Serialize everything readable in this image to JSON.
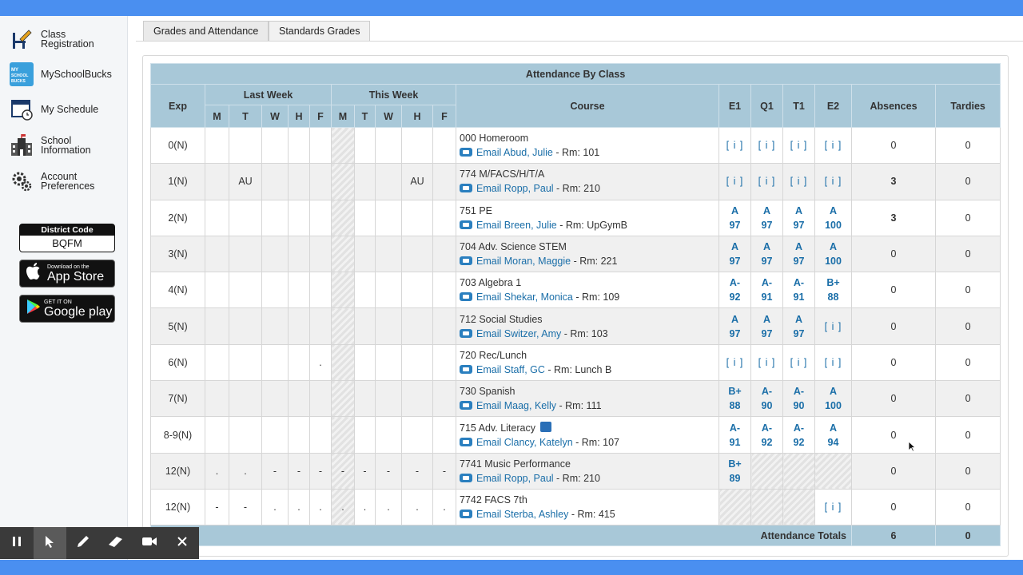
{
  "sidebar": {
    "items": [
      {
        "label": "Class\nRegistration",
        "icon": "pencil-desk-icon"
      },
      {
        "label": "MySchoolBucks",
        "icon": "myschoolbucks-icon"
      },
      {
        "label": "My Schedule",
        "icon": "calendar-clock-icon"
      },
      {
        "label": "School\nInformation",
        "icon": "school-building-icon"
      },
      {
        "label": "Account\nPreferences",
        "icon": "gear-icon"
      }
    ],
    "district_code_label": "District Code",
    "district_code": "BQFM",
    "app_store": {
      "small": "Download on the",
      "big": "App Store"
    },
    "google_play": {
      "small": "GET IT ON",
      "big": "Google play"
    },
    "msb_logo_text": "MY SCHOOL BUCKS"
  },
  "tabs": [
    "Grades and Attendance",
    "Standards Grades"
  ],
  "table": {
    "title": "Attendance By Class",
    "headers": {
      "exp": "Exp",
      "last_week": "Last Week",
      "this_week": "This Week",
      "course": "Course",
      "days": [
        "M",
        "T",
        "W",
        "H",
        "F"
      ],
      "e1": "E1",
      "q1": "Q1",
      "t1": "T1",
      "e2": "E2",
      "absences": "Absences",
      "tardies": "Tardies"
    },
    "rows": [
      {
        "exp": "0(N)",
        "last": [
          "",
          "",
          "",
          "",
          ""
        ],
        "this": [
          "",
          "",
          "",
          "",
          ""
        ],
        "course": "000 Homeroom",
        "email": "Email Abud, Julie",
        "rm": " - Rm: 101",
        "grades": [
          [
            "[ i ]"
          ],
          [
            "[ i ]"
          ],
          [
            "[ i ]"
          ],
          [
            "[ i ]"
          ]
        ],
        "absences": "0",
        "tardies": "0"
      },
      {
        "exp": "1(N)",
        "last": [
          "",
          "AU",
          "",
          "",
          ""
        ],
        "this": [
          "",
          "",
          "",
          "AU",
          ""
        ],
        "course": "774 M/FACS/H/T/A",
        "email": "Email Ropp, Paul",
        "rm": " - Rm: 210",
        "grades": [
          [
            "[ i ]"
          ],
          [
            "[ i ]"
          ],
          [
            "[ i ]"
          ],
          [
            "[ i ]"
          ]
        ],
        "absences": "3",
        "tardies": "0"
      },
      {
        "exp": "2(N)",
        "last": [
          "",
          "",
          "",
          "",
          ""
        ],
        "this": [
          "",
          "",
          "",
          "",
          ""
        ],
        "course": "751 PE",
        "email": "Email Breen, Julie",
        "rm": " - Rm: UpGymB",
        "grades": [
          [
            "A",
            "97"
          ],
          [
            "A",
            "97"
          ],
          [
            "A",
            "97"
          ],
          [
            "A",
            "100"
          ]
        ],
        "absences": "3",
        "tardies": "0"
      },
      {
        "exp": "3(N)",
        "last": [
          "",
          "",
          "",
          "",
          ""
        ],
        "this": [
          "",
          "",
          "",
          "",
          ""
        ],
        "course": "704 Adv. Science STEM",
        "email": "Email Moran, Maggie",
        "rm": " - Rm: 221",
        "grades": [
          [
            "A",
            "97"
          ],
          [
            "A",
            "97"
          ],
          [
            "A",
            "97"
          ],
          [
            "A",
            "100"
          ]
        ],
        "absences": "0",
        "tardies": "0"
      },
      {
        "exp": "4(N)",
        "last": [
          "",
          "",
          "",
          "",
          ""
        ],
        "this": [
          "",
          "",
          "",
          "",
          ""
        ],
        "course": "703 Algebra 1",
        "email": "Email Shekar, Monica",
        "rm": " - Rm: 109",
        "grades": [
          [
            "A-",
            "92"
          ],
          [
            "A-",
            "91"
          ],
          [
            "A-",
            "91"
          ],
          [
            "B+",
            "88"
          ]
        ],
        "absences": "0",
        "tardies": "0"
      },
      {
        "exp": "5(N)",
        "last": [
          "",
          "",
          "",
          "",
          ""
        ],
        "this": [
          "",
          "",
          "",
          "",
          ""
        ],
        "course": "712 Social Studies",
        "email": "Email Switzer, Amy",
        "rm": " - Rm: 103",
        "grades": [
          [
            "A",
            "97"
          ],
          [
            "A",
            "97"
          ],
          [
            "A",
            "97"
          ],
          [
            "[ i ]"
          ]
        ],
        "absences": "0",
        "tardies": "0"
      },
      {
        "exp": "6(N)",
        "last": [
          "",
          "",
          "",
          "",
          "."
        ],
        "this": [
          "",
          "",
          "",
          "",
          ""
        ],
        "course": "720 Rec/Lunch",
        "email": "Email Staff, GC",
        "rm": " - Rm: Lunch B",
        "grades": [
          [
            "[ i ]"
          ],
          [
            "[ i ]"
          ],
          [
            "[ i ]"
          ],
          [
            "[ i ]"
          ]
        ],
        "absences": "0",
        "tardies": "0"
      },
      {
        "exp": "7(N)",
        "last": [
          "",
          "",
          "",
          "",
          ""
        ],
        "this": [
          "",
          "",
          "",
          "",
          ""
        ],
        "course": "730 Spanish",
        "email": "Email Maag, Kelly",
        "rm": " - Rm: 111",
        "grades": [
          [
            "B+",
            "88"
          ],
          [
            "A-",
            "90"
          ],
          [
            "A-",
            "90"
          ],
          [
            "A",
            "100"
          ]
        ],
        "absences": "0",
        "tardies": "0"
      },
      {
        "exp": "8-9(N)",
        "last": [
          "",
          "",
          "",
          "",
          ""
        ],
        "this": [
          "",
          "",
          "",
          "",
          ""
        ],
        "course": "715 Adv. Literacy",
        "email": "Email Clancy, Katelyn",
        "rm": " - Rm: 107",
        "grades": [
          [
            "A-",
            "91"
          ],
          [
            "A-",
            "92"
          ],
          [
            "A-",
            "92"
          ],
          [
            "A",
            "94"
          ]
        ],
        "absences": "0",
        "tardies": "0",
        "group_icon": true
      },
      {
        "exp": "12(N)",
        "last": [
          ".",
          ".",
          "-",
          "-",
          "-"
        ],
        "this": [
          "-",
          "-",
          "-",
          "-",
          "-"
        ],
        "course": "7741 Music Performance",
        "email": "Email Ropp, Paul",
        "rm": " - Rm: 210",
        "grades": [
          [
            "B+",
            "89"
          ],
          [],
          [],
          []
        ],
        "absences": "0",
        "tardies": "0"
      },
      {
        "exp": "12(N)",
        "last": [
          "-",
          "-",
          ".",
          ".",
          "."
        ],
        "this": [
          ".",
          ".",
          ".",
          ".",
          "."
        ],
        "course": "7742 FACS 7th",
        "email": "Email Sterba, Ashley",
        "rm": " - Rm: 415",
        "grades": [
          [],
          [],
          [],
          [
            "[ i ]"
          ]
        ],
        "absences": "0",
        "tardies": "0"
      }
    ],
    "totals": {
      "label": "Attendance Totals",
      "absences": "6",
      "tardies": "0"
    }
  },
  "toolbar": [
    "pause-icon",
    "pointer-icon",
    "pen-icon",
    "eraser-icon",
    "camera-icon",
    "close-icon"
  ]
}
